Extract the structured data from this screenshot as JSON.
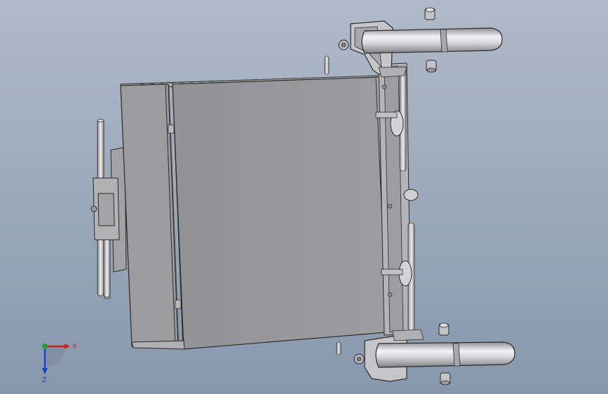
{
  "colors": {
    "background_top": "#aeb9c8",
    "background_bottom": "#8696ab",
    "body_face": "#9a9a9c",
    "body_edge": "#2a2a2a",
    "metal_light": "#e6e6e8",
    "metal_mid": "#b8b8bc",
    "x_axis": "#d22020",
    "y_axis": "#22a032",
    "z_axis": "#2040c8"
  },
  "triad": {
    "x_label": "X",
    "z_label": "Z"
  }
}
